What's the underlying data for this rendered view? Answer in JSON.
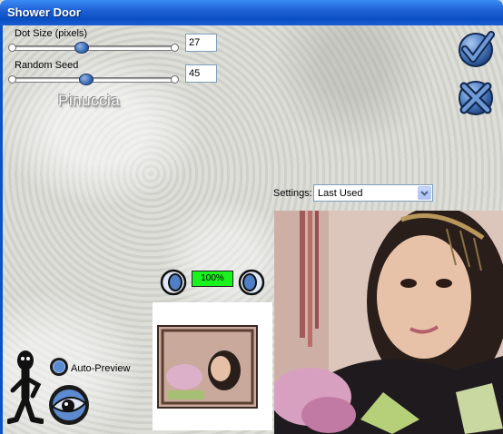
{
  "window": {
    "title": "Shower Door"
  },
  "controls": {
    "dot_size": {
      "label": "Dot Size (pixels)",
      "value": "27"
    },
    "random_seed": {
      "label": "Random Seed",
      "value": "45"
    }
  },
  "watermark": "Pinuccia",
  "settings": {
    "label": "Settings:",
    "selected": "Last Used"
  },
  "preview": {
    "zoom": "100%"
  },
  "auto_preview": {
    "label": "Auto-Preview"
  },
  "icons": {
    "ok": "checkmark-icon",
    "cancel": "cross-icon",
    "zoom_out": "zoom-out-icon",
    "zoom_in": "zoom-in-icon",
    "auto_preview_toggle": "radio-icon",
    "eye": "eye-icon",
    "mascot": "stick-figure-icon"
  },
  "colors": {
    "titlebar": "#0a4fc4",
    "zoom_indicator": "#19f21c",
    "button_blue": "#2f5fa8"
  }
}
